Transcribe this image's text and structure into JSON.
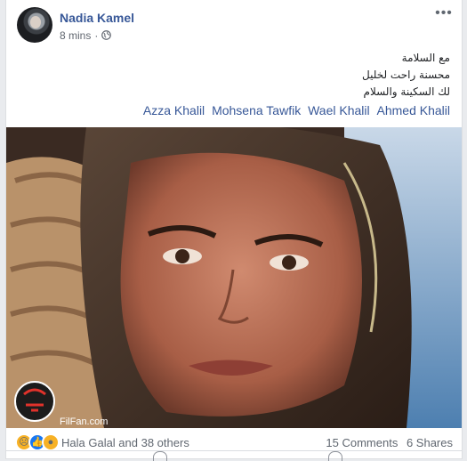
{
  "post": {
    "author": "Nadia Kamel",
    "time": "8 mins",
    "separator": "·",
    "privacy_icon": "globe-icon",
    "more_icon": "more-options-icon",
    "text_lines": [
      "مع السلامة",
      "محسنة راحت لخليل",
      "لك السكينة والسلام"
    ],
    "tags": [
      "Azza Khalil",
      "Mohsena Tawfik",
      "Wael Khalil",
      "Ahmed Khalil"
    ]
  },
  "photo": {
    "watermark_text": "FilFan.com",
    "logo_text": "FilFan"
  },
  "engagement": {
    "reactions": [
      "sad-icon",
      "like-icon",
      "wow-icon"
    ],
    "reaction_names": "Hala Galal and 38 others",
    "comments": "15 Comments",
    "shares": "6 Shares"
  },
  "colors": {
    "link": "#385898",
    "secondary_text": "#616770",
    "like_blue": "#1877f2",
    "reaction_yellow": "#f7b125"
  }
}
